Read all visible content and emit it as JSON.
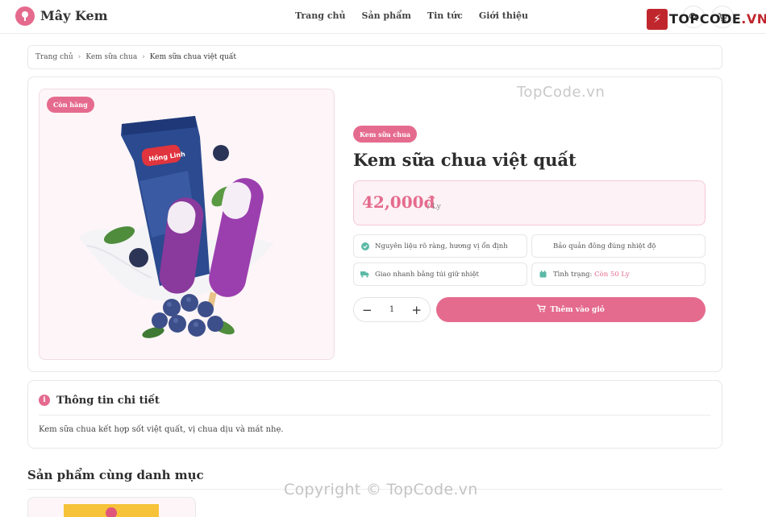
{
  "header": {
    "logo_text": "Mây Kem",
    "nav": [
      "Trang chủ",
      "Sản phẩm",
      "Tin tức",
      "Giới thiệu"
    ]
  },
  "watermark": {
    "brand": "TOPCODE",
    "brand_suffix": ".VN",
    "overlay_text": "TopCode.vn",
    "copyright": "Copyright © TopCode.vn"
  },
  "breadcrumb": [
    "Trang chủ",
    "Kem sữa chua",
    "Kem sữa chua việt quất"
  ],
  "product": {
    "stock_badge": "Còn hàng",
    "category": "Kem sữa chua",
    "name": "Kem sữa chua việt quất",
    "price": "42,000đ",
    "unit": "/ Ly",
    "packaging_text": "Hồng Linh",
    "features": [
      {
        "icon": "check-circle-icon",
        "text": "Nguyên liệu rõ ràng, hương vị ổn định"
      },
      {
        "icon": "snowflake-icon",
        "text": "Bảo quản đông đúng nhiệt độ"
      },
      {
        "icon": "truck-icon",
        "text": "Giao nhanh bằng túi giữ nhiệt"
      },
      {
        "icon": "box-icon",
        "text": "Tình trạng:",
        "highlight": "Còn 50 Ly"
      }
    ],
    "quantity": "1",
    "add_to_cart": "Thêm vào giỏ"
  },
  "details": {
    "title": "Thông tin chi tiết",
    "text": "Kem sữa chua kết hợp sốt việt quất, vị chua dịu và mát nhẹ."
  },
  "related": {
    "title": "Sản phẩm cùng danh mục"
  },
  "colors": {
    "accent": "#e56b8e",
    "accent_light": "#fdf2f5",
    "border": "#e8e8e8",
    "brand_red": "#c0272d"
  }
}
